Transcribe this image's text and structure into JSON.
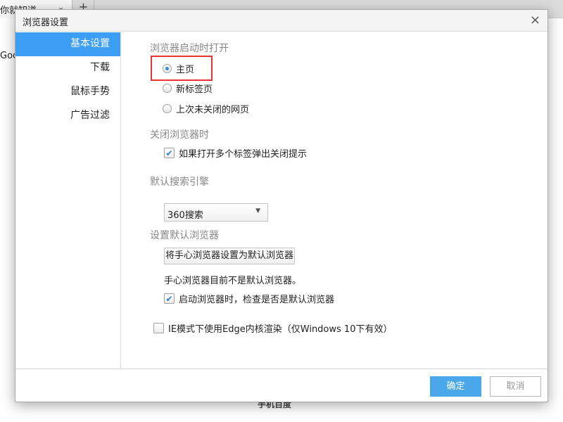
{
  "background": {
    "tab_title": "你就知道",
    "new_tab": "+",
    "address_fragment": "Goo",
    "bottom_text": "手机百度"
  },
  "dialog": {
    "title": "浏览器设置",
    "close": "×",
    "sidebar": {
      "items": [
        {
          "label": "基本设置",
          "active": true
        },
        {
          "label": "下载"
        },
        {
          "label": "鼠标手势"
        },
        {
          "label": "广告过滤"
        }
      ]
    },
    "startup": {
      "heading": "浏览器启动时打开",
      "options": [
        {
          "label": "主页",
          "selected": true
        },
        {
          "label": "新标签页",
          "selected": false
        },
        {
          "label": "上次未关闭的网页",
          "selected": false
        }
      ]
    },
    "close_browser": {
      "heading": "关闭浏览器时",
      "option": {
        "label": "如果打开多个标签弹出关闭提示",
        "checked": true
      }
    },
    "search": {
      "heading": "默认搜索引擎",
      "selected": "360搜索"
    },
    "default_browser": {
      "heading": "设置默认浏览器",
      "button": "将手心浏览器设置为默认浏览器",
      "status": "手心浏览器目前不是默认浏览器。",
      "check": {
        "label": "启动浏览器时，检查是否是默认浏览器",
        "checked": true
      }
    },
    "ie_mode": {
      "label": "IE模式下使用Edge内核渲染（仅Windows 10下有效）",
      "checked": false
    },
    "footer": {
      "ok": "确定",
      "cancel": "取消"
    },
    "colors": {
      "accent": "#3d9ef5",
      "ok_button": "#4aa8ea",
      "highlight_box": "#ec3434"
    }
  }
}
